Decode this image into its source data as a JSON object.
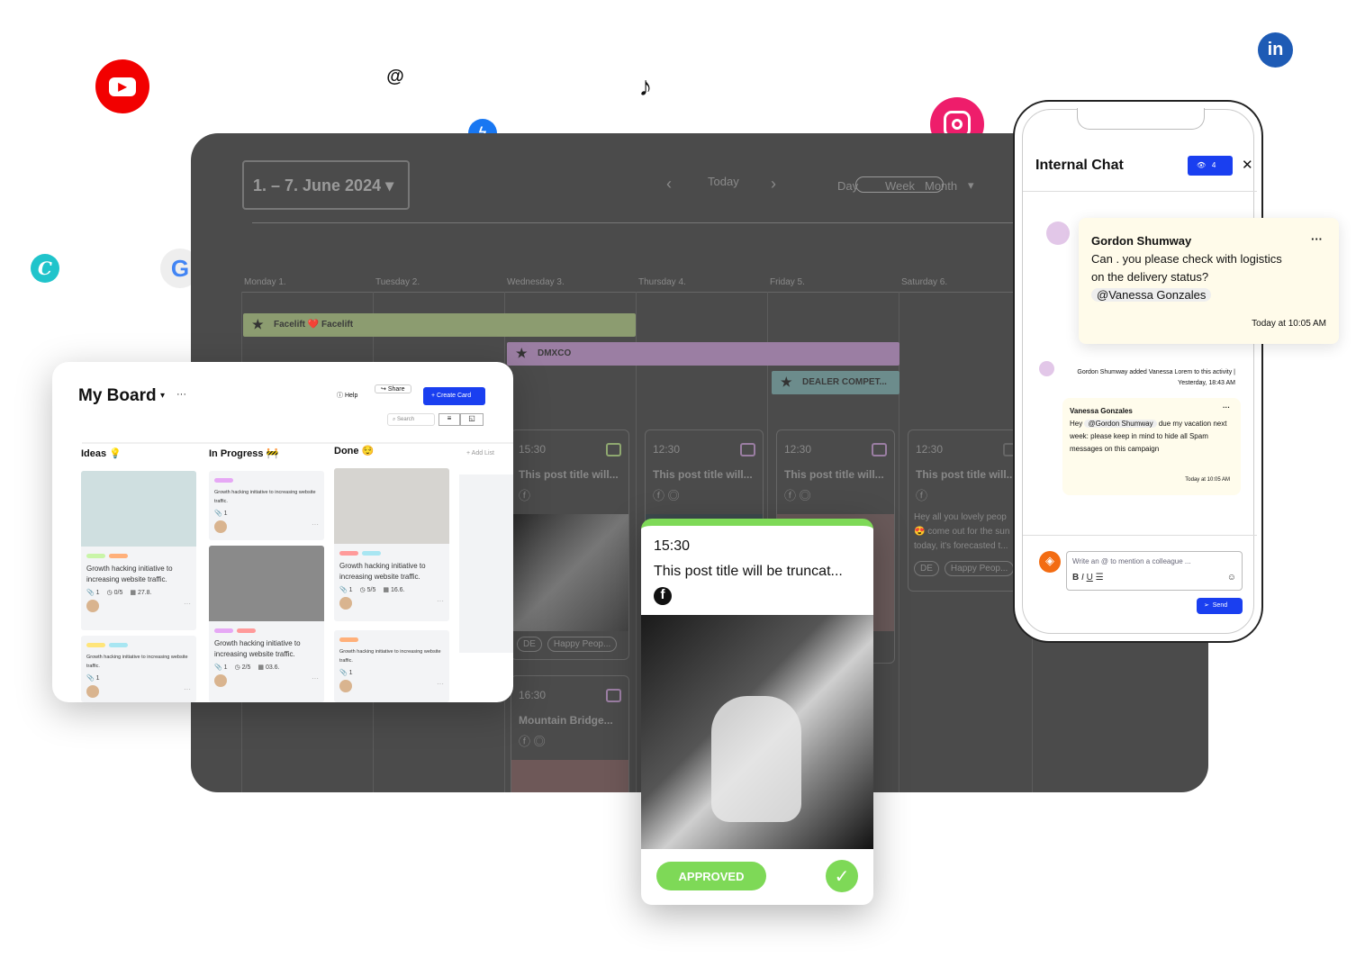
{
  "calendar": {
    "date_range": "1. – 7. June 2024",
    "prev": "‹",
    "today": "Today",
    "next": "›",
    "views": [
      "Day",
      "Week",
      "Month"
    ],
    "days": [
      "Monday 1.",
      "Tuesday 2.",
      "Wednesday 3.",
      "Thursday 4.",
      "Friday 5.",
      "Saturday 6."
    ],
    "events": [
      {
        "label": "Facelift ❤️ Facelift",
        "color": "#8c9c70"
      },
      {
        "label": "DMXCO",
        "color": "#9b7ea3"
      },
      {
        "label": "DEALER COMPET...",
        "color": "#6c8c8c"
      }
    ],
    "posts": [
      {
        "time": "15:30",
        "title": "This post title will...",
        "icons": "ⓕ",
        "chips": [
          "DE",
          "Happy Peop..."
        ],
        "accent": "#8fa870"
      },
      {
        "time": "12:30",
        "title": "This post title will...",
        "icons": "ⓕ ◎",
        "accent": "#9b7ea3"
      },
      {
        "time": "12:30",
        "title": "This post title will...",
        "icons": "ⓕ ◎",
        "accent": "#9b7ea3"
      },
      {
        "time": "12:30",
        "title": "This post title will...",
        "icons": "ⓕ",
        "text": "Hey all you lovely peop 😍 come out for the sun today, it's forecasted t...",
        "chips": [
          "DE",
          "Happy Peop..."
        ],
        "accent": "#666"
      },
      {
        "time": "16:30",
        "title": "Mountain Bridge...",
        "icons": "ⓕ ◎",
        "accent": "#9b7ea3"
      }
    ]
  },
  "board": {
    "title": "My Board",
    "more": "···",
    "help": "Help",
    "share": "Share",
    "create": "+ Create Card",
    "search_placeholder": "Search",
    "add_list": "+ Add List",
    "columns": [
      {
        "name": "Ideas 💡",
        "cards": [
          {
            "image": "#cfdfe0",
            "tags": [
              "#c9f5a8",
              "#ffb07a"
            ],
            "text": "Growth hacking initiative to increasing website traffic.",
            "attach": "1",
            "checks": "0/5",
            "date": "27.8."
          },
          {
            "tags": [
              "#ffe57a",
              "#a8e6f2"
            ],
            "text": "Growth hacking initiative to increasing website traffic.",
            "attach": "1"
          }
        ]
      },
      {
        "name": "In Progress 🚧",
        "cards": [
          {
            "tags": [
              "#e6a8f5"
            ],
            "text": "Growth hacking initiative to increasing website traffic.",
            "attach": "1"
          },
          {
            "image": "#8a8a8a",
            "tags": [
              "#e6a8f5",
              "#ff9a9a"
            ],
            "text": "Growth hacking initiative to increasing website traffic.",
            "attach": "1",
            "checks": "2/5",
            "date": "03.6."
          }
        ]
      },
      {
        "name": "Done 😌",
        "cards": [
          {
            "image": "#d6d4d0",
            "tags": [
              "#ff9a9a",
              "#a8e6f2"
            ],
            "text": "Growth hacking initiative to increasing website traffic.",
            "attach": "1",
            "checks": "5/5",
            "date": "16.6."
          },
          {
            "tags": [
              "#ffb07a"
            ],
            "text": "Growth hacking initiative to increasing website traffic.",
            "attach": "1"
          }
        ]
      }
    ]
  },
  "popup": {
    "time": "15:30",
    "title": "This post title will be truncat...",
    "status": "APPROVED",
    "accent": "#7ed957"
  },
  "chat": {
    "title": "Internal Chat",
    "viewers": "4",
    "msg1": {
      "author": "Gordon Shumway",
      "text": "Can                 .        you please check with logistics on the delivery status?",
      "mention": "@Vanessa Gonzales",
      "time": "Today at 10:05 AM"
    },
    "activity": "Gordon Shumway added Vanessa Lorem to this activity | Yesterday, 18:43 AM",
    "msg2": {
      "author": "Vanessa Gonzales",
      "pre": "Hey",
      "mention": "@Gordon Shumway",
      "text": "due my vacation next week: please keep in mind to hide all Spam messages on this campaign",
      "time": "Today at 10:05 AM"
    },
    "input_placeholder": "Write an @ to mention a colleague ...",
    "send": "Send",
    "format": [
      "B",
      "I",
      "U",
      "☰"
    ]
  },
  "colors": {
    "brand_blue": "#1a3ff0",
    "dark_panel": "#4b4b4b",
    "approved": "#7ed957"
  }
}
